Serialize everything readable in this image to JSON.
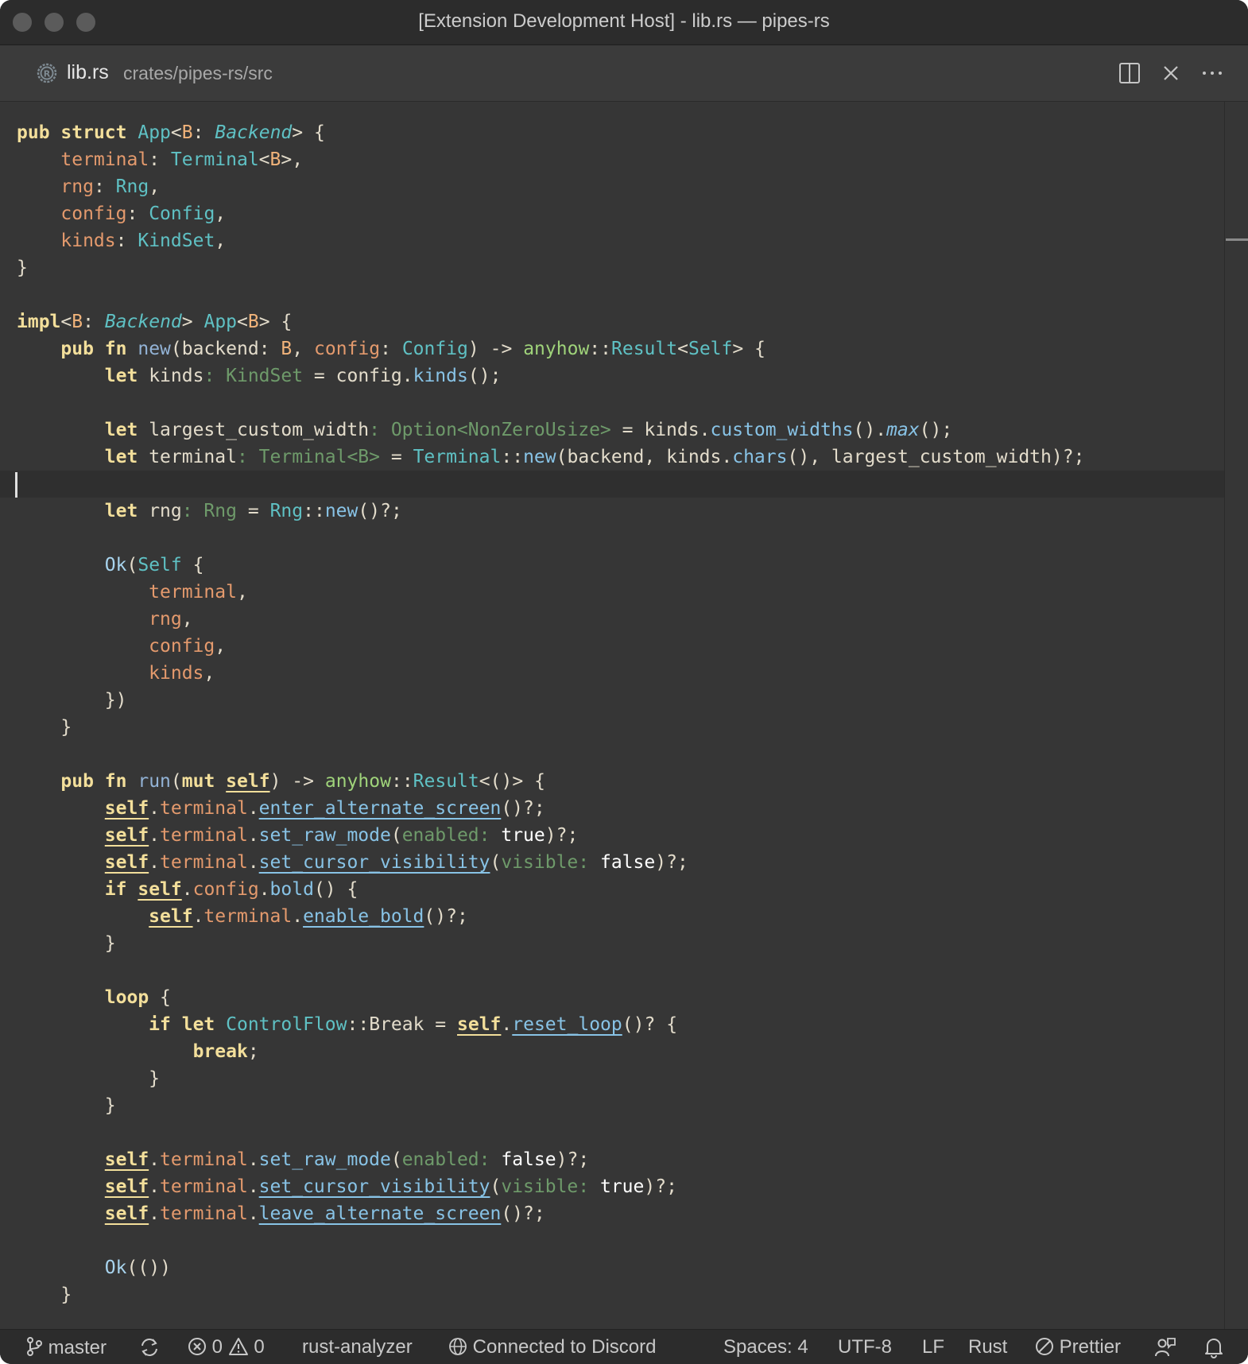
{
  "window": {
    "title": "[Extension Development Host] - lib.rs — pipes-rs"
  },
  "tab": {
    "filename": "lib.rs",
    "path": "crates/pipes-rs/src",
    "icon": "rust-icon",
    "actions": [
      "split-editor-icon",
      "close-icon",
      "more-actions-icon"
    ]
  },
  "code": {
    "lines": [
      "pub struct App<B: Backend> {",
      "    terminal: Terminal<B>,",
      "    rng: Rng,",
      "    config: Config,",
      "    kinds: KindSet,",
      "}",
      "",
      "impl<B: Backend> App<B> {",
      "    pub fn new(backend: B, config: Config) -> anyhow::Result<Self> {",
      "        let kinds: KindSet = config.kinds();",
      "",
      "        let largest_custom_width: Option<NonZeroUsize> = kinds.custom_widths().max();",
      "        let terminal: Terminal<B> = Terminal::new(backend, kinds.chars(), largest_custom_width)?;",
      "",
      "        let rng: Rng = Rng::new()?;",
      "",
      "        Ok(Self {",
      "            terminal,",
      "            rng,",
      "            config,",
      "            kinds,",
      "        })",
      "    }",
      "",
      "    pub fn run(mut self) -> anyhow::Result<()> {",
      "        self.terminal.enter_alternate_screen()?;",
      "        self.terminal.set_raw_mode(enabled: true)?;",
      "        self.terminal.set_cursor_visibility(visible: false)?;",
      "        if self.config.bold() {",
      "            self.terminal.enable_bold()?;",
      "        }",
      "",
      "        loop {",
      "            if let ControlFlow::Break = self.reset_loop()? {",
      "                break;",
      "            }",
      "        }",
      "",
      "        self.terminal.set_raw_mode(enabled: false)?;",
      "        self.terminal.set_cursor_visibility(visible: true)?;",
      "        self.terminal.leave_alternate_screen()?;",
      "",
      "        Ok(())",
      "    }"
    ],
    "cursor_line": 14
  },
  "status": {
    "branch": "master",
    "errors": "0",
    "warnings": "0",
    "language_server": "rust-analyzer",
    "discord": "Connected to Discord",
    "indent": "Spaces: 4",
    "encoding": "UTF-8",
    "eol": "LF",
    "language": "Rust",
    "formatter": "Prettier"
  },
  "colors": {
    "keyword": "#f3df9b",
    "type": "#5fc1c4",
    "field": "#e49a6d",
    "method": "#88c3e6",
    "inlay_hint": "#6e9a6a",
    "background": "#363636"
  }
}
